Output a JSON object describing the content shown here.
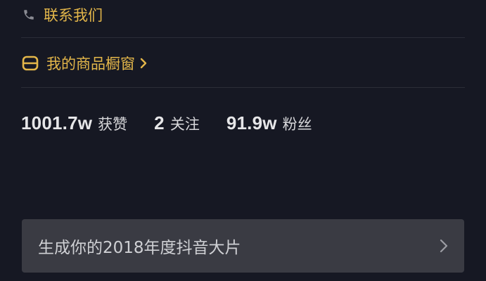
{
  "profile": {
    "contact_label": "联系我们",
    "shop_label": "我的商品橱窗",
    "stats": [
      {
        "value": "1001.7w",
        "label": "获赞"
      },
      {
        "value": "2",
        "label": "关注"
      },
      {
        "value": "91.9w",
        "label": "粉丝"
      }
    ],
    "banner_label": "生成你的2018年度抖音大片"
  },
  "colors": {
    "background": "#161823",
    "accent": "#e3b64a",
    "banner_bg": "#3a3b43",
    "text_primary": "#e6e6e8"
  },
  "icons": {
    "contact": "phone-icon",
    "shop": "shop-window-icon",
    "shop_chevron": "chevron-right-icon",
    "banner_chevron": "chevron-right-icon"
  }
}
